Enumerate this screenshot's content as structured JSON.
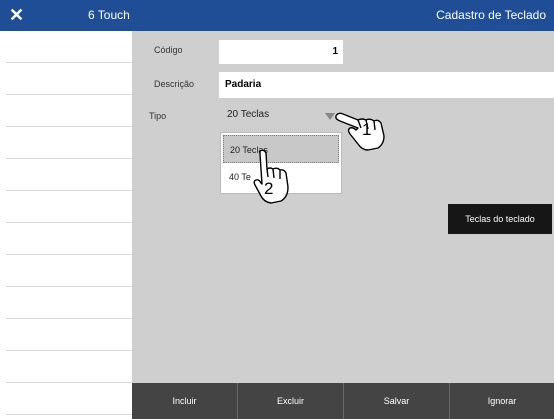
{
  "titlebar": {
    "close_icon": "close-icon",
    "app_name": "6 Touch",
    "screen_title": "Cadastro de Teclado"
  },
  "form": {
    "codigo": {
      "label": "Código",
      "value": "1"
    },
    "descricao": {
      "label": "Descrição",
      "value": "Padaria"
    },
    "tipo": {
      "label": "Tipo",
      "value": "20 Teclas",
      "options": [
        "20 Teclas",
        "40 Teclas"
      ],
      "options_visible": [
        "20 Teclas",
        "40 Te"
      ]
    }
  },
  "keys_button": {
    "label": "Teclas do teclado"
  },
  "bottom_buttons": [
    {
      "label": "Incluir"
    },
    {
      "label": "Excluir"
    },
    {
      "label": "Salvar"
    },
    {
      "label": "Ignorar"
    }
  ],
  "annotations": [
    {
      "number": "1",
      "icon": "pointing-hand-icon"
    },
    {
      "number": "2",
      "icon": "pointing-hand-icon"
    }
  ],
  "colors": {
    "titlebar": "#1f4e96",
    "content_bg": "#cfcfcf",
    "bottombar": "#444444",
    "keys_button": "#161616"
  }
}
